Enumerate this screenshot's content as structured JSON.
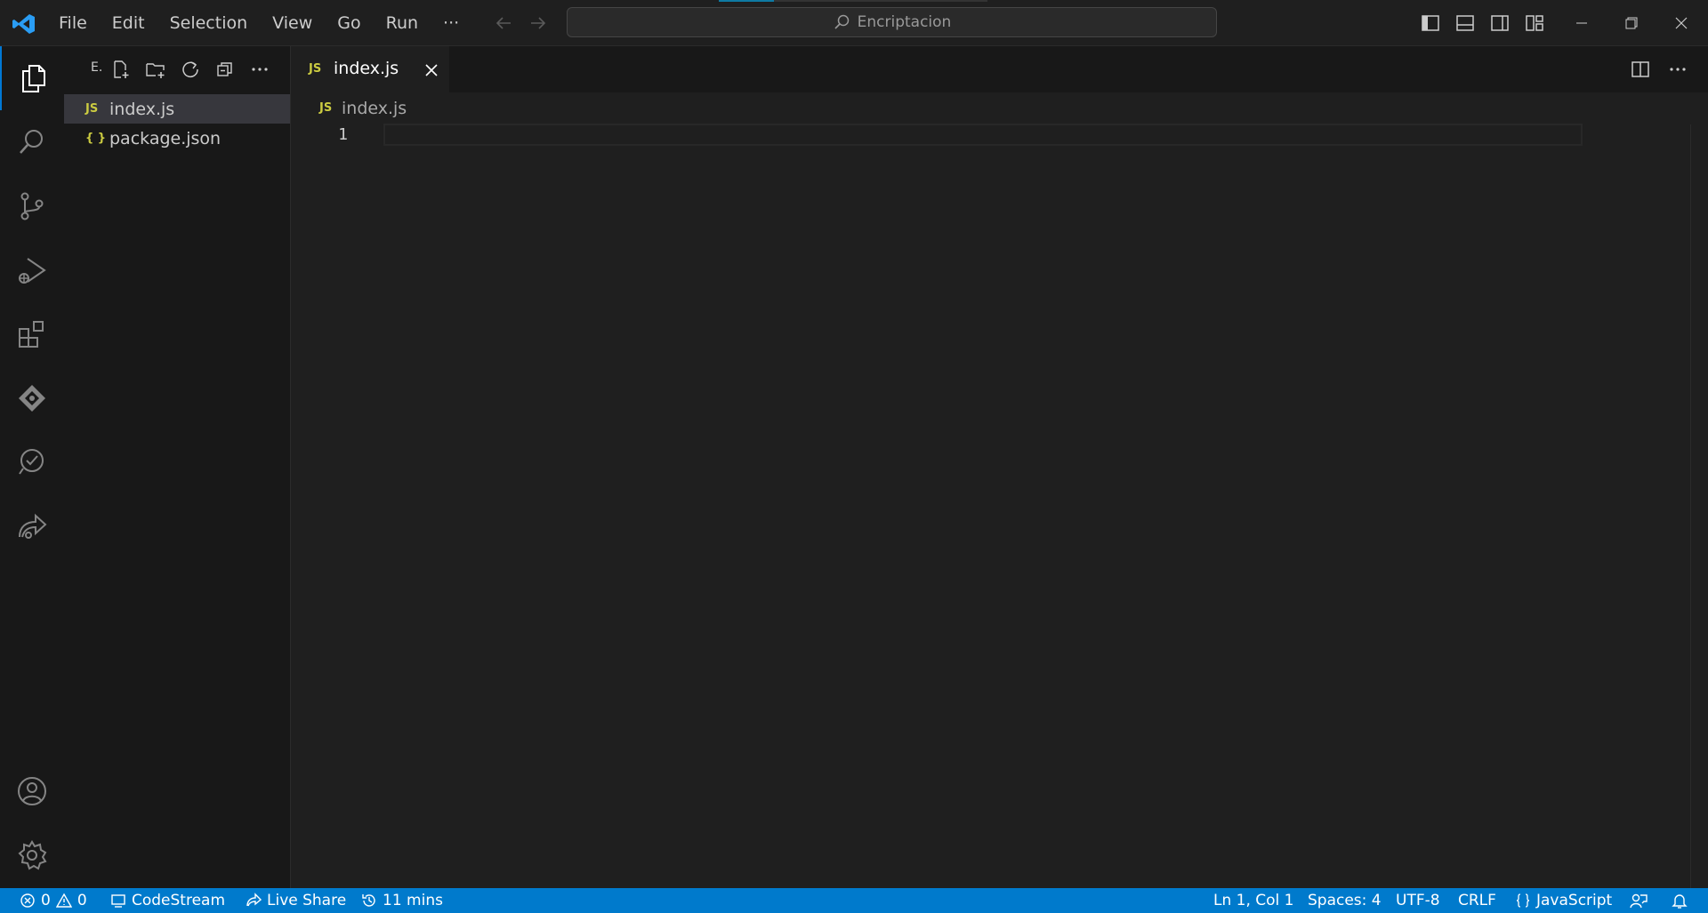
{
  "menu": {
    "items": [
      "File",
      "Edit",
      "Selection",
      "View",
      "Go",
      "Run",
      "···"
    ]
  },
  "command_center": {
    "text": "Encriptacion"
  },
  "sidebar": {
    "title": "E.",
    "files": [
      {
        "icon": "JS",
        "name": "index.js",
        "selected": true
      },
      {
        "icon": "{ }",
        "name": "package.json",
        "selected": false
      }
    ]
  },
  "editor": {
    "tab": {
      "icon": "JS",
      "label": "index.js"
    },
    "breadcrumb": {
      "icon": "JS",
      "label": "index.js"
    },
    "line_number": "1"
  },
  "statusbar": {
    "errors": "0",
    "warnings": "0",
    "codestream": "CodeStream",
    "liveshare": "Live Share",
    "time": "11 mins",
    "position": "Ln 1, Col 1",
    "spaces": "Spaces: 4",
    "encoding": "UTF-8",
    "eol": "CRLF",
    "language": "JavaScript"
  },
  "colors": {
    "accent": "#0078d4",
    "statusbar": "#007acc",
    "js_icon": "#cbcb41"
  }
}
